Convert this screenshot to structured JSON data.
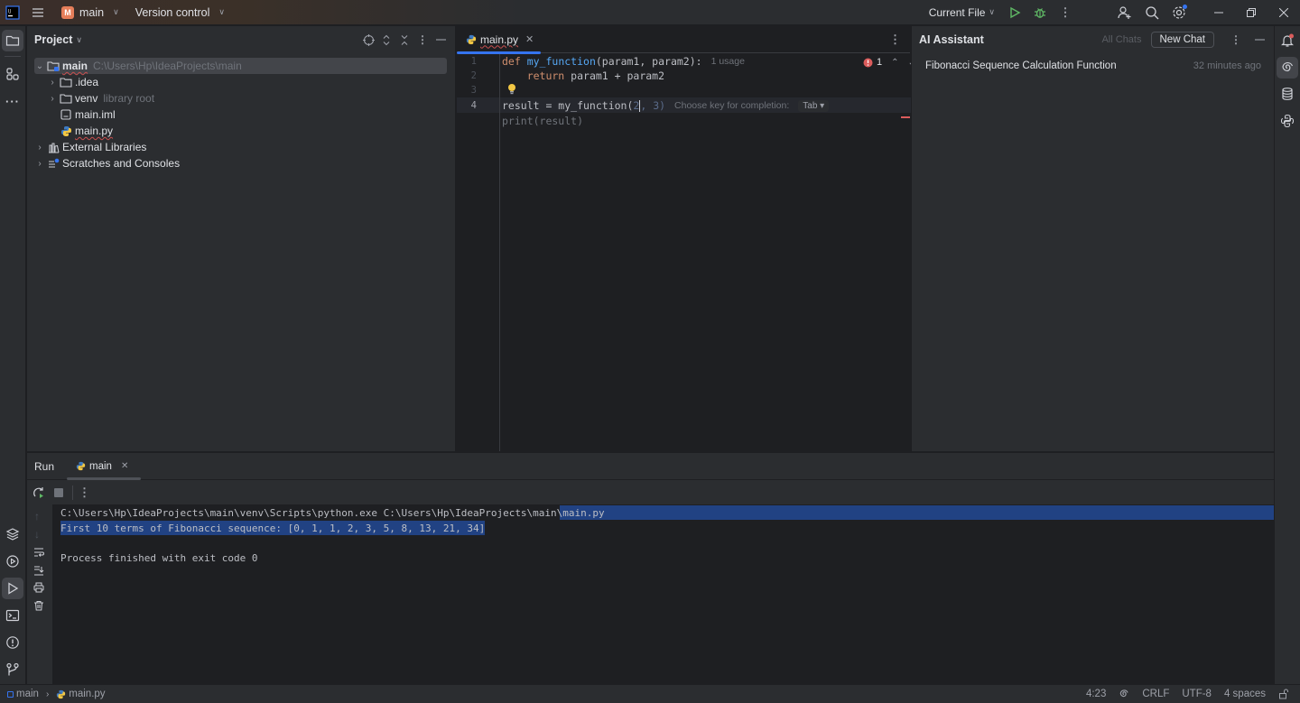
{
  "titlebar": {
    "project_initial": "M",
    "project_name": "main",
    "vcs_label": "Version control",
    "run_config": "Current File"
  },
  "project_panel": {
    "title": "Project",
    "tree": [
      {
        "label": "main",
        "hint": "C:\\Users\\Hp\\IdeaProjects\\main",
        "icon": "project-folder-icon",
        "expanded": true,
        "selected": true
      },
      {
        "label": ".idea",
        "hint": "",
        "icon": "folder-icon",
        "expanded": false
      },
      {
        "label": "venv",
        "hint": "library root",
        "icon": "folder-icon",
        "expanded": false
      },
      {
        "label": "main.iml",
        "hint": "",
        "icon": "iml-file-icon"
      },
      {
        "label": "main.py",
        "hint": "",
        "icon": "python-file-icon"
      },
      {
        "label": "External Libraries",
        "hint": "",
        "icon": "library-icon",
        "expanded": false
      },
      {
        "label": "Scratches and Consoles",
        "hint": "",
        "icon": "scratches-icon",
        "expanded": false
      }
    ]
  },
  "editor": {
    "tab_label": "main.py",
    "line_numbers": [
      "1",
      "2",
      "3",
      "4"
    ],
    "code": {
      "l1_kw": "def ",
      "l1_fn": "my_function",
      "l1_rest": "(param1, param2):",
      "l1_hint": "1 usage",
      "l2_kw": "    return ",
      "l2_rest": "param1 + param2",
      "l4_a": "result = my_function(",
      "l4_b": "2",
      "l4_ghost": ", 3)",
      "l4_hint": "Choose key for completion:",
      "l4_key": "Tab ▾",
      "l5_ghost": "print(result)"
    },
    "error_count": "1"
  },
  "ai_assistant": {
    "title": "AI Assistant",
    "all_chats": "All Chats",
    "new_chat": "New Chat",
    "chats": [
      {
        "title": "Fibonacci Sequence Calculation Function",
        "time": "32 minutes ago"
      }
    ]
  },
  "run_panel": {
    "title": "Run",
    "tab_label": "main",
    "console": [
      "C:\\Users\\Hp\\IdeaProjects\\main\\venv\\Scripts\\python.exe C:\\Users\\Hp\\IdeaProjects\\main\\main.py",
      "First 10 terms of Fibonacci sequence: [0, 1, 1, 2, 3, 5, 8, 13, 21, 34]",
      "",
      "Process finished with exit code 0"
    ]
  },
  "statusbar": {
    "breadcrumb_project": "main",
    "breadcrumb_file": "main.py",
    "position": "4:23",
    "line_ending": "CRLF",
    "encoding": "UTF-8",
    "indent": "4 spaces"
  },
  "colors": {
    "accent": "#3574f0",
    "selection": "#214283",
    "error": "#db5c5c",
    "run_green": "#5fb865"
  }
}
